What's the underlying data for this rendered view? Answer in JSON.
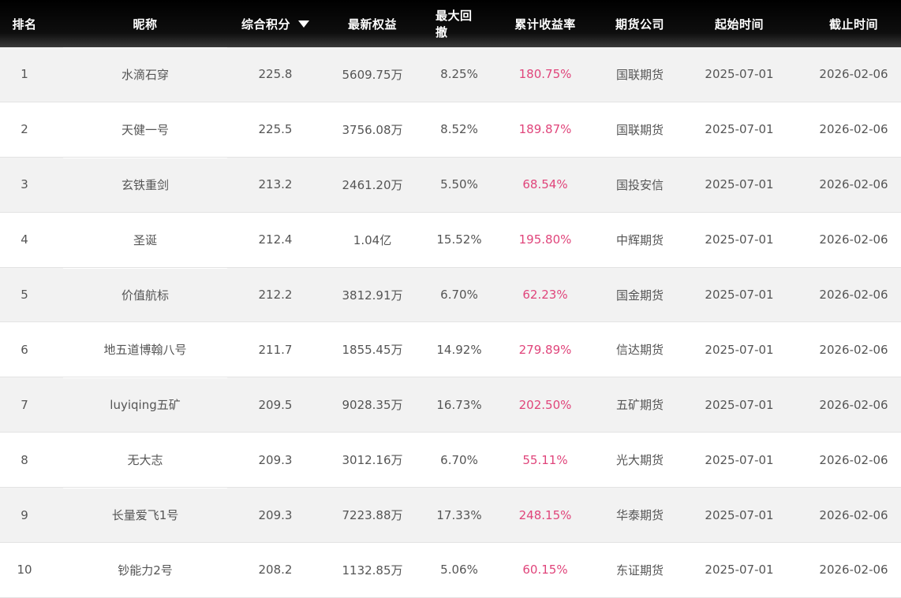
{
  "columns": {
    "rank": "排名",
    "nickname": "昵称",
    "score": "综合积分",
    "equity": "最新权益",
    "max_drawdown": "最大回撤",
    "cum_return": "累计收益率",
    "company": "期货公司",
    "start_date": "起始时间",
    "end_date": "截止时间"
  },
  "sort": {
    "column": "score",
    "direction": "desc",
    "icon": "caret-down-icon"
  },
  "colors": {
    "header_bg": "#000000",
    "return_text": "#e0457b",
    "stripe": "#f2f2f2"
  },
  "rows": [
    {
      "rank": "1",
      "nickname": "水滴石穿",
      "score": "225.8",
      "equity": "5609.75万",
      "max_drawdown": "8.25%",
      "cum_return": "180.75%",
      "company": "国联期货",
      "start_date": "2025-07-01",
      "end_date": "2026-02-06"
    },
    {
      "rank": "2",
      "nickname": "天健一号",
      "score": "225.5",
      "equity": "3756.08万",
      "max_drawdown": "8.52%",
      "cum_return": "189.87%",
      "company": "国联期货",
      "start_date": "2025-07-01",
      "end_date": "2026-02-06"
    },
    {
      "rank": "3",
      "nickname": "玄铁重剑",
      "score": "213.2",
      "equity": "2461.20万",
      "max_drawdown": "5.50%",
      "cum_return": "68.54%",
      "company": "国投安信",
      "start_date": "2025-07-01",
      "end_date": "2026-02-06"
    },
    {
      "rank": "4",
      "nickname": "圣诞",
      "score": "212.4",
      "equity": "1.04亿",
      "max_drawdown": "15.52%",
      "cum_return": "195.80%",
      "company": "中辉期货",
      "start_date": "2025-07-01",
      "end_date": "2026-02-06"
    },
    {
      "rank": "5",
      "nickname": "价值航标",
      "score": "212.2",
      "equity": "3812.91万",
      "max_drawdown": "6.70%",
      "cum_return": "62.23%",
      "company": "国金期货",
      "start_date": "2025-07-01",
      "end_date": "2026-02-06"
    },
    {
      "rank": "6",
      "nickname": "地五道博翰八号",
      "score": "211.7",
      "equity": "1855.45万",
      "max_drawdown": "14.92%",
      "cum_return": "279.89%",
      "company": "信达期货",
      "start_date": "2025-07-01",
      "end_date": "2026-02-06"
    },
    {
      "rank": "7",
      "nickname": "luyiqing五矿",
      "score": "209.5",
      "equity": "9028.35万",
      "max_drawdown": "16.73%",
      "cum_return": "202.50%",
      "company": "五矿期货",
      "start_date": "2025-07-01",
      "end_date": "2026-02-06"
    },
    {
      "rank": "8",
      "nickname": "无大志",
      "score": "209.3",
      "equity": "3012.16万",
      "max_drawdown": "6.70%",
      "cum_return": "55.11%",
      "company": "光大期货",
      "start_date": "2025-07-01",
      "end_date": "2026-02-06"
    },
    {
      "rank": "9",
      "nickname": "长量爱飞1号",
      "score": "209.3",
      "equity": "7223.88万",
      "max_drawdown": "17.33%",
      "cum_return": "248.15%",
      "company": "华泰期货",
      "start_date": "2025-07-01",
      "end_date": "2026-02-06"
    },
    {
      "rank": "10",
      "nickname": "钞能力2号",
      "score": "208.2",
      "equity": "1132.85万",
      "max_drawdown": "5.06%",
      "cum_return": "60.15%",
      "company": "东证期货",
      "start_date": "2025-07-01",
      "end_date": "2026-02-06"
    }
  ]
}
